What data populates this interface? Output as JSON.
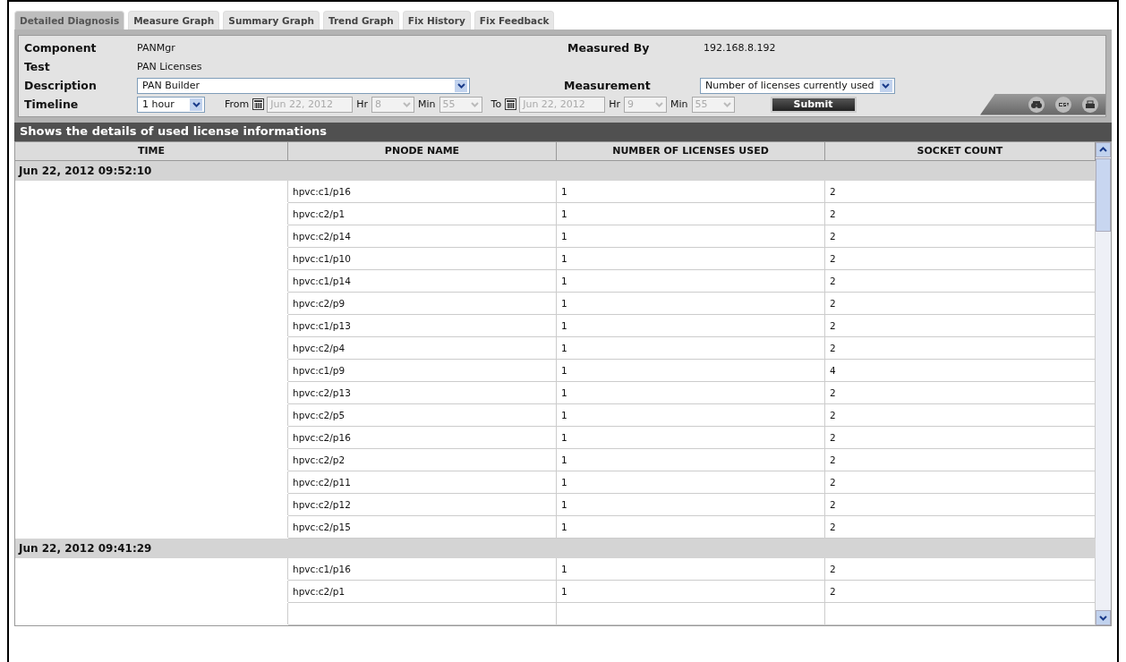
{
  "tabs": [
    {
      "label": "Detailed Diagnosis",
      "selected": true
    },
    {
      "label": "Measure Graph",
      "selected": false
    },
    {
      "label": "Summary Graph",
      "selected": false
    },
    {
      "label": "Trend Graph",
      "selected": false
    },
    {
      "label": "Fix History",
      "selected": false
    },
    {
      "label": "Fix Feedback",
      "selected": false
    }
  ],
  "form": {
    "component": {
      "label": "Component",
      "value": "PANMgr"
    },
    "test": {
      "label": "Test",
      "value": "PAN Licenses"
    },
    "measured_by": {
      "label": "Measured By",
      "value": "192.168.8.192"
    },
    "description": {
      "label": "Description",
      "value": "PAN Builder"
    },
    "measurement": {
      "label": "Measurement",
      "value": "Number of licenses currently used"
    },
    "timeline": {
      "label": "Timeline",
      "value": "1 hour"
    },
    "from": {
      "label": "From",
      "date": "Jun 22, 2012",
      "hr_label": "Hr",
      "hr": "8",
      "min_label": "Min",
      "min": "55"
    },
    "to": {
      "label": "To",
      "date": "Jun 22, 2012",
      "hr_label": "Hr",
      "hr": "9",
      "min_label": "Min",
      "min": "55"
    },
    "submit": "Submit"
  },
  "table": {
    "title": "Shows the details of used license informations",
    "columns": [
      "TIME",
      "PNODE NAME",
      "NUMBER OF LICENSES USED",
      "SOCKET COUNT"
    ],
    "groups": [
      {
        "time": "Jun 22, 2012 09:52:10",
        "rows": [
          [
            "hpvc:c1/p16",
            "1",
            "2"
          ],
          [
            "hpvc:c2/p1",
            "1",
            "2"
          ],
          [
            "hpvc:c2/p14",
            "1",
            "2"
          ],
          [
            "hpvc:c1/p10",
            "1",
            "2"
          ],
          [
            "hpvc:c1/p14",
            "1",
            "2"
          ],
          [
            "hpvc:c2/p9",
            "1",
            "2"
          ],
          [
            "hpvc:c1/p13",
            "1",
            "2"
          ],
          [
            "hpvc:c2/p4",
            "1",
            "2"
          ],
          [
            "hpvc:c1/p9",
            "1",
            "4"
          ],
          [
            "hpvc:c2/p13",
            "1",
            "2"
          ],
          [
            "hpvc:c2/p5",
            "1",
            "2"
          ],
          [
            "hpvc:c2/p16",
            "1",
            "2"
          ],
          [
            "hpvc:c2/p2",
            "1",
            "2"
          ],
          [
            "hpvc:c2/p11",
            "1",
            "2"
          ],
          [
            "hpvc:c2/p12",
            "1",
            "2"
          ],
          [
            "hpvc:c2/p15",
            "1",
            "2"
          ]
        ]
      },
      {
        "time": "Jun 22, 2012 09:41:29",
        "rows": [
          [
            "hpvc:c1/p16",
            "1",
            "2"
          ],
          [
            "hpvc:c2/p1",
            "1",
            "2"
          ]
        ]
      }
    ]
  }
}
